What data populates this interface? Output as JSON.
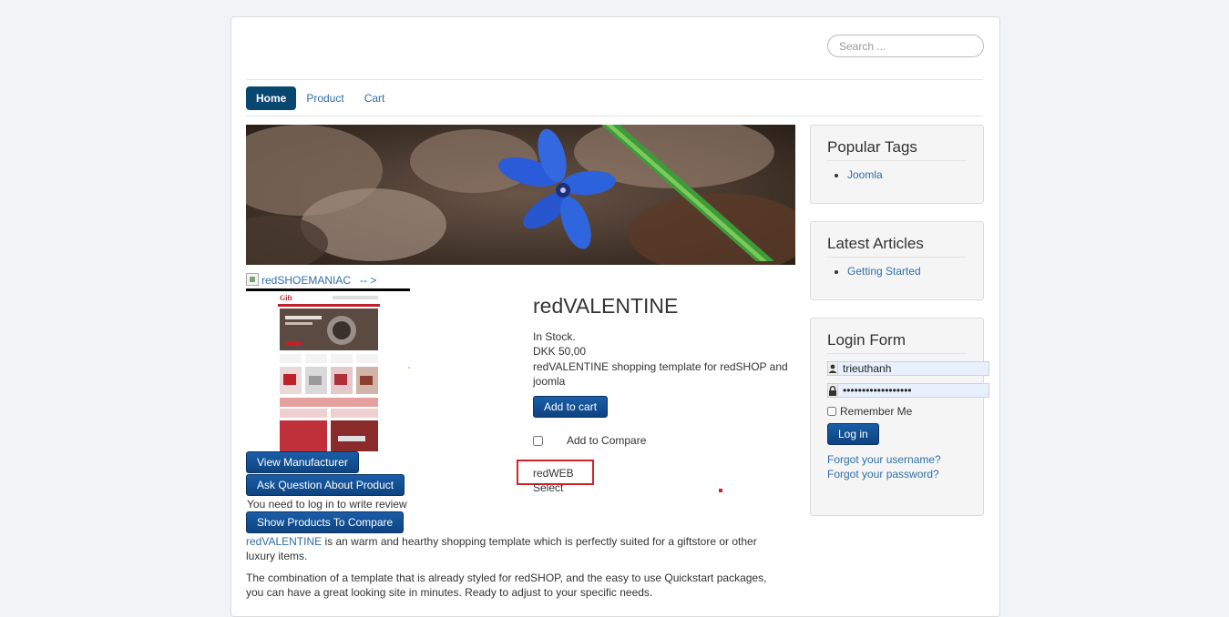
{
  "search": {
    "placeholder": "Search ..."
  },
  "nav": {
    "items": [
      "Home",
      "Product",
      "Cart"
    ],
    "active": "Home"
  },
  "manufacturer_link": {
    "label": "redSHOEMANIAC",
    "arrow": "-- >"
  },
  "product": {
    "title": "redVALENTINE",
    "stock": "In Stock.",
    "price": "DKK 50,00",
    "short_desc": "redVALENTINE shopping template for redSHOP and joomla",
    "add_to_cart": "Add to cart",
    "compare_label": "Add to Compare",
    "manufacturer": "redWEB",
    "select_label": "Select"
  },
  "actions": {
    "view_manufacturer": "View Manufacturer",
    "ask_question": "Ask Question About Product",
    "login_review": "You need to log in to write review",
    "show_compare": "Show Products To Compare"
  },
  "description": {
    "link": "redVALENTINE",
    "p1_rest": " is an warm and hearthy shopping template which is perfectly suited for a giftstore or other luxury items.",
    "p2": "The combination of a template that is already styled for redSHOP, and the easy to use Quickstart packages, you can have a great looking site in minutes. Ready to adjust to your specific needs."
  },
  "sidebar": {
    "popular_tags": {
      "title": "Popular Tags",
      "items": [
        "Joomla"
      ]
    },
    "latest_articles": {
      "title": "Latest Articles",
      "items": [
        "Getting Started"
      ]
    },
    "login": {
      "title": "Login Form",
      "username": "trieuthanh",
      "password_mask": "••••••••••••••••••",
      "remember": "Remember Me",
      "login_button": "Log in",
      "forgot_username": "Forgot your username?",
      "forgot_password": "Forgot your password?"
    }
  },
  "colors": {
    "nav_active": "#08476f",
    "link": "#2f6fab",
    "button": "#0d4381",
    "highlight": "#d72029"
  }
}
